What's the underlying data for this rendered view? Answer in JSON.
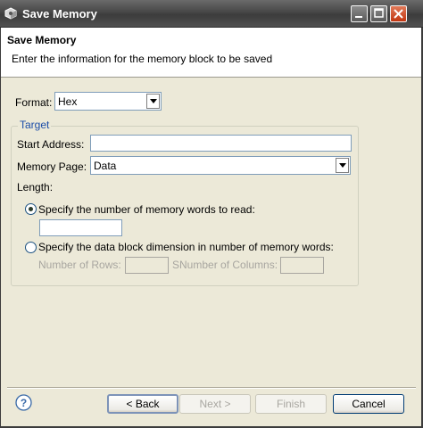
{
  "window": {
    "title": "Save Memory",
    "icon": "gear-cube-icon",
    "controls": [
      "minimize-icon",
      "maximize-icon",
      "close-icon"
    ]
  },
  "header": {
    "title": "Save Memory",
    "description": "Enter the information for the memory block to be saved"
  },
  "form": {
    "format_label": "Format:",
    "format_value": "Hex",
    "target_legend": "Target",
    "start_address_label": "Start Address:",
    "start_address_value": "",
    "memory_page_label": "Memory Page:",
    "memory_page_value": "Data",
    "length_label": "Length:",
    "radio_words_label": "Specify the number of memory words to read:",
    "radio_words_selected": true,
    "words_value": "",
    "radio_dimension_label": "Specify the data block dimension in number of memory words:",
    "radio_dimension_selected": false,
    "rows_label": "Number of Rows:",
    "columns_label": "SNumber of Columns:",
    "rows_value": "",
    "columns_value": ""
  },
  "footer": {
    "help_icon": "help-icon",
    "back_label": "< Back",
    "next_label": "Next >",
    "finish_label": "Finish",
    "cancel_label": "Cancel",
    "next_enabled": false,
    "finish_enabled": false
  },
  "colors": {
    "titlebar": "#474747",
    "dialog_bg": "#ece9d8",
    "legend_text": "#1c4ea8",
    "close_button": "#c2350f"
  }
}
